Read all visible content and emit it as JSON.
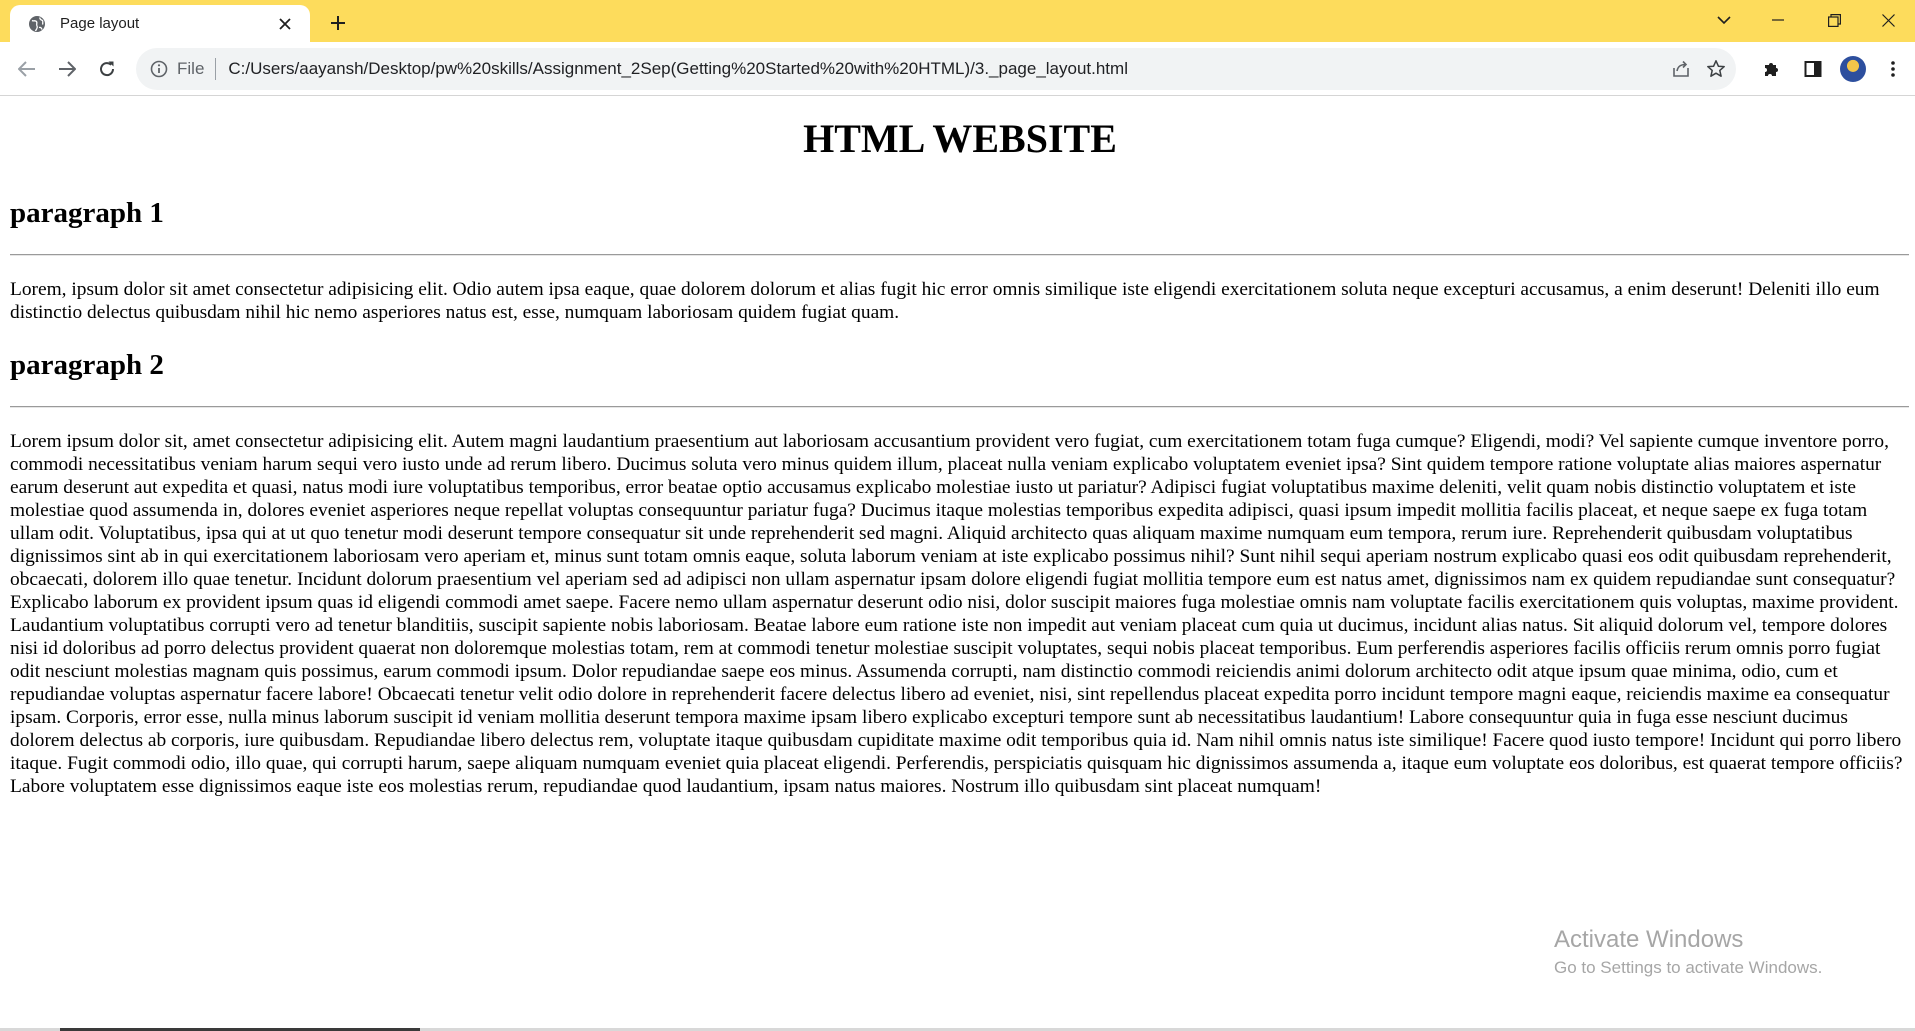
{
  "browser": {
    "tab": {
      "title": "Page layout",
      "favicon": "globe-icon",
      "close_icon": "close-icon"
    },
    "new_tab_icon": "plus-icon",
    "window_controls": [
      "tab-search-chevron-icon",
      "minimize-icon",
      "restore-icon",
      "close-icon"
    ],
    "nav_icons": [
      "back-arrow-icon",
      "forward-arrow-icon",
      "reload-icon"
    ],
    "omnibox": {
      "security_icon": "info-icon",
      "site_label": "File",
      "url": "C:/Users/aayansh/Desktop/pw%20skills/Assignment_2Sep(Getting%20Started%20with%20HTML)/3._page_layout.html",
      "action_icons": [
        "share-icon",
        "star-bookmark-icon"
      ]
    },
    "toolbar_icons": [
      "extensions-puzzle-icon",
      "side-panel-icon",
      "profile-avatar",
      "kebab-menu-icon"
    ],
    "colors": {
      "tabstrip": "#fddc5c",
      "active_tab": "#ffffff",
      "omnibox": "#f1f3f4"
    }
  },
  "page": {
    "heading": "HTML WEBSITE",
    "sections": [
      {
        "title": "paragraph 1",
        "body": "Lorem, ipsum dolor sit amet consectetur adipisicing elit. Odio autem ipsa eaque, quae dolorem dolorum et alias fugit hic error omnis similique iste eligendi exercitationem soluta neque excepturi accusamus, a enim deserunt! Deleniti illo eum distinctio delectus quibusdam nihil hic nemo asperiores natus est, esse, numquam laboriosam quidem fugiat quam."
      },
      {
        "title": "paragraph 2",
        "body": "Lorem ipsum dolor sit, amet consectetur adipisicing elit. Autem magni laudantium praesentium aut laboriosam accusantium provident vero fugiat, cum exercitationem totam fuga cumque? Eligendi, modi? Vel sapiente cumque inventore porro, commodi necessitatibus veniam harum sequi vero iusto unde ad rerum libero. Ducimus soluta vero minus quidem illum, placeat nulla veniam explicabo voluptatem eveniet ipsa? Sint quidem tempore ratione voluptate alias maiores aspernatur earum deserunt aut expedita et quasi, natus modi iure voluptatibus temporibus, error beatae optio accusamus explicabo molestiae iusto ut pariatur? Adipisci fugiat voluptatibus maxime deleniti, velit quam nobis distinctio voluptatem et iste molestiae quod assumenda in, dolores eveniet asperiores neque repellat voluptas consequuntur pariatur fuga? Ducimus itaque molestias temporibus expedita adipisci, quasi ipsum impedit mollitia facilis placeat, et neque saepe ex fuga totam ullam odit. Voluptatibus, ipsa qui at ut quo tenetur modi deserunt tempore consequatur sit unde reprehenderit sed magni. Aliquid architecto quas aliquam maxime numquam eum tempora, rerum iure. Reprehenderit quibusdam voluptatibus dignissimos sint ab in qui exercitationem laboriosam vero aperiam et, minus sunt totam omnis eaque, soluta laborum veniam at iste explicabo possimus nihil? Sunt nihil sequi aperiam nostrum explicabo quasi eos odit quibusdam reprehenderit, obcaecati, dolorem illo quae tenetur. Incidunt dolorum praesentium vel aperiam sed ad adipisci non ullam aspernatur ipsam dolore eligendi fugiat mollitia tempore eum est natus amet, dignissimos nam ex quidem repudiandae sunt consequatur? Explicabo laborum ex provident ipsum quas id eligendi commodi amet saepe. Facere nemo ullam aspernatur deserunt odio nisi, dolor suscipit maiores fuga molestiae omnis nam voluptate facilis exercitationem quis voluptas, maxime provident. Laudantium voluptatibus corrupti vero ad tenetur blanditiis, suscipit sapiente nobis laboriosam. Beatae labore eum ratione iste non impedit aut veniam placeat cum quia ut ducimus, incidunt alias natus. Sit aliquid dolorum vel, tempore dolores nisi id doloribus ad porro delectus provident quaerat non doloremque molestias totam, rem at commodi tenetur molestiae suscipit voluptates, sequi nobis placeat temporibus. Eum perferendis asperiores facilis officiis rerum omnis porro fugiat odit nesciunt molestias magnam quis possimus, earum commodi ipsum. Dolor repudiandae saepe eos minus. Assumenda corrupti, nam distinctio commodi reiciendis animi dolorum architecto odit atque ipsum quae minima, odio, cum et repudiandae voluptas aspernatur facere labore! Obcaecati tenetur velit odio dolore in reprehenderit facere delectus libero ad eveniet, nisi, sint repellendus placeat expedita porro incidunt tempore magni eaque, reiciendis maxime ea consequatur ipsam. Corporis, error esse, nulla minus laborum suscipit id veniam mollitia deserunt tempora maxime ipsam libero explicabo excepturi tempore sunt ab necessitatibus laudantium! Labore consequuntur quia in fuga esse nesciunt ducimus dolorem delectus ab corporis, iure quibusdam. Repudiandae libero delectus rem, voluptate itaque quibusdam cupiditate maxime odit temporibus quia id. Nam nihil omnis natus iste similique! Facere quod iusto tempore! Incidunt qui porro libero itaque. Fugit commodi odio, illo quae, qui corrupti harum, saepe aliquam numquam eveniet quia placeat eligendi. Perferendis, perspiciatis quisquam hic dignissimos assumenda a, itaque eum voluptate eos doloribus, est quaerat tempore officiis? Labore voluptatem esse dignissimos eaque iste eos molestias rerum, repudiandae quod laudantium, ipsam natus maiores. Nostrum illo quibusdam sint placeat numquam!"
      }
    ]
  },
  "watermark": {
    "title": "Activate Windows",
    "subtitle": "Go to Settings to activate Windows."
  }
}
